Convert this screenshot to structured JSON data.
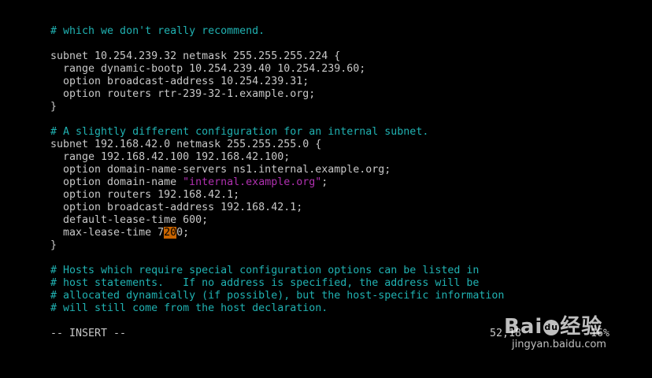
{
  "editor": {
    "lines": [
      {
        "type": "comment",
        "text": "# which we don't really recommend."
      },
      {
        "type": "blank",
        "text": ""
      },
      {
        "type": "code",
        "text": "subnet 10.254.239.32 netmask 255.255.255.224 {"
      },
      {
        "type": "code",
        "text": "  range dynamic-bootp 10.254.239.40 10.254.239.60;"
      },
      {
        "type": "code",
        "text": "  option broadcast-address 10.254.239.31;"
      },
      {
        "type": "code",
        "text": "  option routers rtr-239-32-1.example.org;"
      },
      {
        "type": "code",
        "text": "}"
      },
      {
        "type": "blank",
        "text": ""
      },
      {
        "type": "comment",
        "text": "# A slightly different configuration for an internal subnet."
      },
      {
        "type": "code",
        "text": "subnet 192.168.42.0 netmask 255.255.255.0 {"
      },
      {
        "type": "code",
        "text": "  range 192.168.42.100 192.168.42.100;"
      },
      {
        "type": "code",
        "text": "  option domain-name-servers ns1.internal.example.org;"
      },
      {
        "type": "code-string",
        "before": "  option domain-name ",
        "string": "\"internal.example.org\"",
        "after": ";"
      },
      {
        "type": "code",
        "text": "  option routers 192.168.42.1;"
      },
      {
        "type": "code",
        "text": "  option broadcast-address 192.168.42.1;"
      },
      {
        "type": "code",
        "text": "  default-lease-time 600;"
      },
      {
        "type": "code-cursor",
        "before": "  max-lease-time 7",
        "cursor": "20",
        "after": "0;"
      },
      {
        "type": "code",
        "text": "}"
      },
      {
        "type": "blank",
        "text": ""
      },
      {
        "type": "comment",
        "text": "# Hosts which require special configuration options can be listed in"
      },
      {
        "type": "comment",
        "text": "# host statements.   If no address is specified, the address will be"
      },
      {
        "type": "comment",
        "text": "# allocated dynamically (if possible), but the host-specific information"
      },
      {
        "type": "comment",
        "text": "# will still come from the host declaration."
      }
    ]
  },
  "status": {
    "mode": "-- INSERT --",
    "position": "52,18",
    "percent": "16%"
  },
  "watermark": {
    "logo_left": "Bai",
    "logo_paw": "du",
    "logo_right": "经验",
    "url": "jingyan.baidu.com"
  },
  "colors": {
    "background": "#000000",
    "text": "#c8c8c8",
    "comment": "#20b2b2",
    "string": "#b030b0",
    "cursor": "#c86400"
  }
}
